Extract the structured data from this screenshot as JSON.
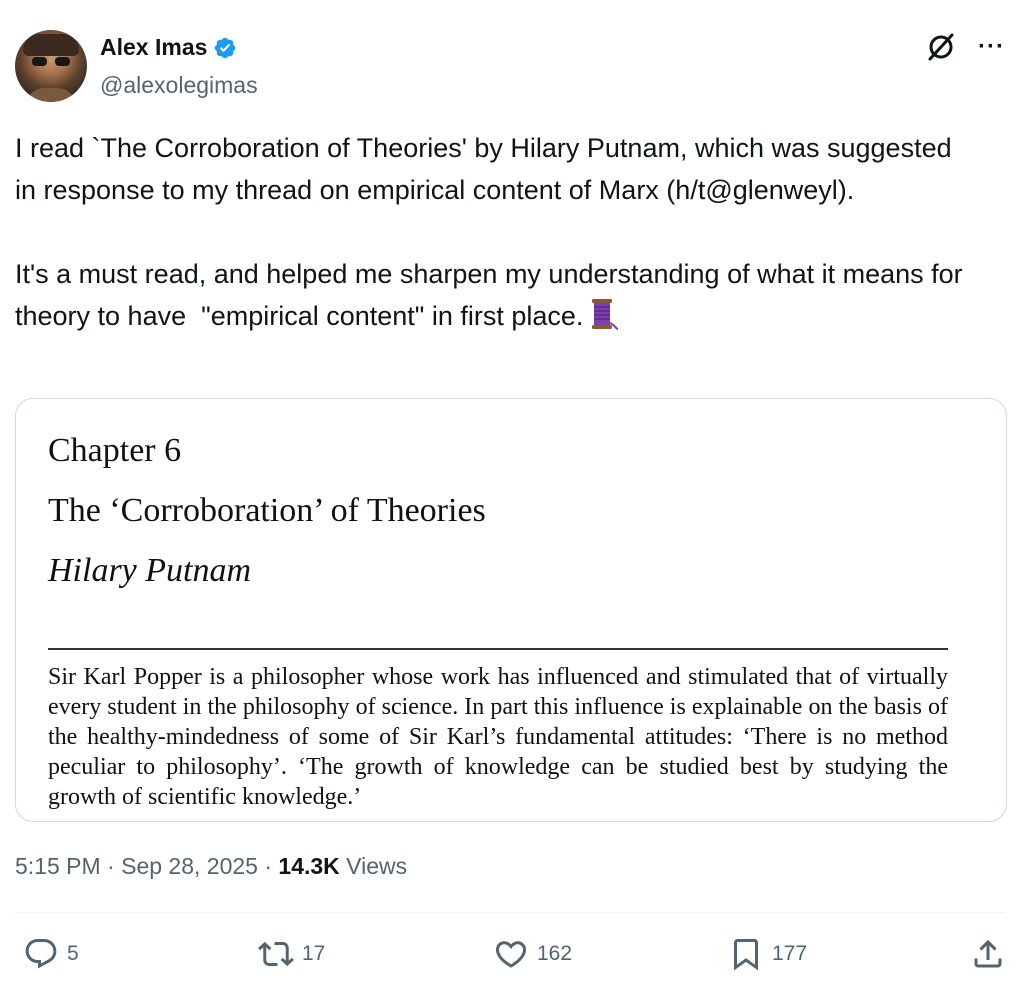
{
  "author": {
    "display_name": "Alex Imas",
    "handle": "@alexolegimas"
  },
  "tweet": {
    "paragraph_1": "I read `The Corroboration of Theories' by Hilary Putnam, which was suggested in response to my thread on empirical content of Marx (h/t@glenweyl).",
    "paragraph_2": "It's a must read, and helped me sharpen my understanding of what it means for theory to have  \"empirical content\" in first place.",
    "emoji": "thread-spool-emoji"
  },
  "media": {
    "chapter": "Chapter 6",
    "title": "The ‘Corroboration’ of Theories",
    "author": "Hilary Putnam",
    "excerpt": "Sir Karl Popper is a philosopher whose work has influenced and stimulated that of virtually every student in the philosophy of science. In part this influence is explainable on the basis of the healthy-mindedness of some of Sir Karl’s fundamental attitudes: ‘There is no method peculiar to philosophy’. ‘The growth of knowledge can be studied best by studying the growth of scientific knowledge.’"
  },
  "meta": {
    "time": "5:15 PM",
    "separator": " · ",
    "date": "Sep 28, 2025",
    "views_count": "14.3K",
    "views_label": " Views"
  },
  "actions": {
    "replies": "5",
    "reposts": "17",
    "likes": "162",
    "bookmarks": "177"
  },
  "icons": {
    "verified": "verified-badge-icon",
    "grok": "grok-icon",
    "more": "more-icon",
    "reply": "reply-icon",
    "repost": "repost-icon",
    "like": "heart-icon",
    "bookmark": "bookmark-icon",
    "share": "share-icon"
  },
  "colors": {
    "verified_blue": "#1d9bf0",
    "secondary_text": "#536471",
    "primary_text": "#0f1419",
    "border": "#cfd9de"
  }
}
